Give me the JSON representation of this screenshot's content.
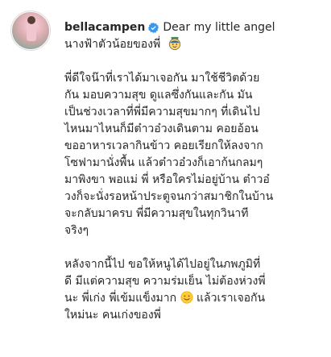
{
  "post": {
    "username": "bellacampen",
    "caption_first": "Dear my little angel",
    "line2": "นางฟ้าตัวน้อยของพี่",
    "emoji_1": "angel-face-emoji",
    "p1": [
      "พี่ดีใจน๊าที่เราได้มาเจอกัน มาใช้ชีวิตด้วย",
      "กัน มอบความสุข ดูแลซึ่งกันและกัน มัน",
      "เป็นช่วงเวลาที่พี่มีความสุขมากๆ ที่เดินไป",
      "ไหนมาไหนก็มีต๋าวอ๋วงเดินตาม คอยอ้อน",
      "ขออาหารเวลากินข้าว คอยเรียกให้ลงจาก",
      "โซฟามานั่งพื้น แล้วต๋าวอ๋วงก็เอาก้นกลมๆ",
      "มาพิงขา พอแม่ พี่ หรือใครไม่อยู่บ้าน ต๋าวอ๋",
      "วงก็จะนั่งรอหน้าประตูจนกว่าสมาชิกในบ้าน",
      "จะกลับมาครบ พี่มีความสุขในทุกวินาที",
      "จริงๆ"
    ],
    "p2": [
      "หลังจากนี้ไป ขอให้หนูได้ไปอยู่ในภพภูมิที่",
      "ดี มีแต่ความสุข ความร่มเย็น ไม่ต้องห่วงพี่",
      "นะ พี่เก่ง พี่เข้มแข็งมาก"
    ],
    "p2_last_tail": "แล้วเราเจอกัน",
    "p2_final": "ใหม่นะ คนเก่งของพี่",
    "emoji_2": "smiling-face-emoji",
    "colors": {
      "text": "#262626",
      "verified": "#3897f0"
    }
  }
}
